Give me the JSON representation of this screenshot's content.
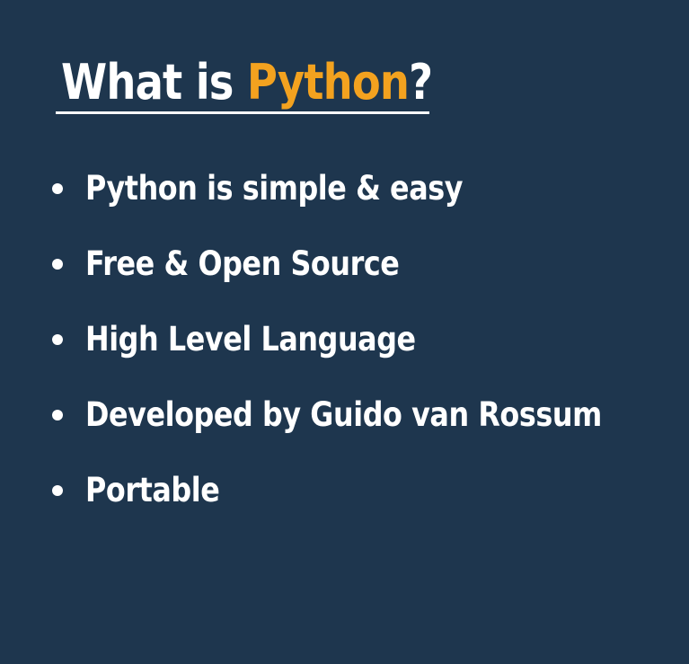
{
  "slide": {
    "title_prefix": "What is ",
    "title_highlight": "Python",
    "title_suffix": "?",
    "bullets": [
      "Python is simple & easy",
      "Free & Open Source",
      "High Level Language",
      "Developed by Guido van Rossum",
      "Portable"
    ]
  },
  "colors": {
    "background": "#1e364e",
    "text": "#ffffff",
    "accent": "#f3a21f"
  }
}
